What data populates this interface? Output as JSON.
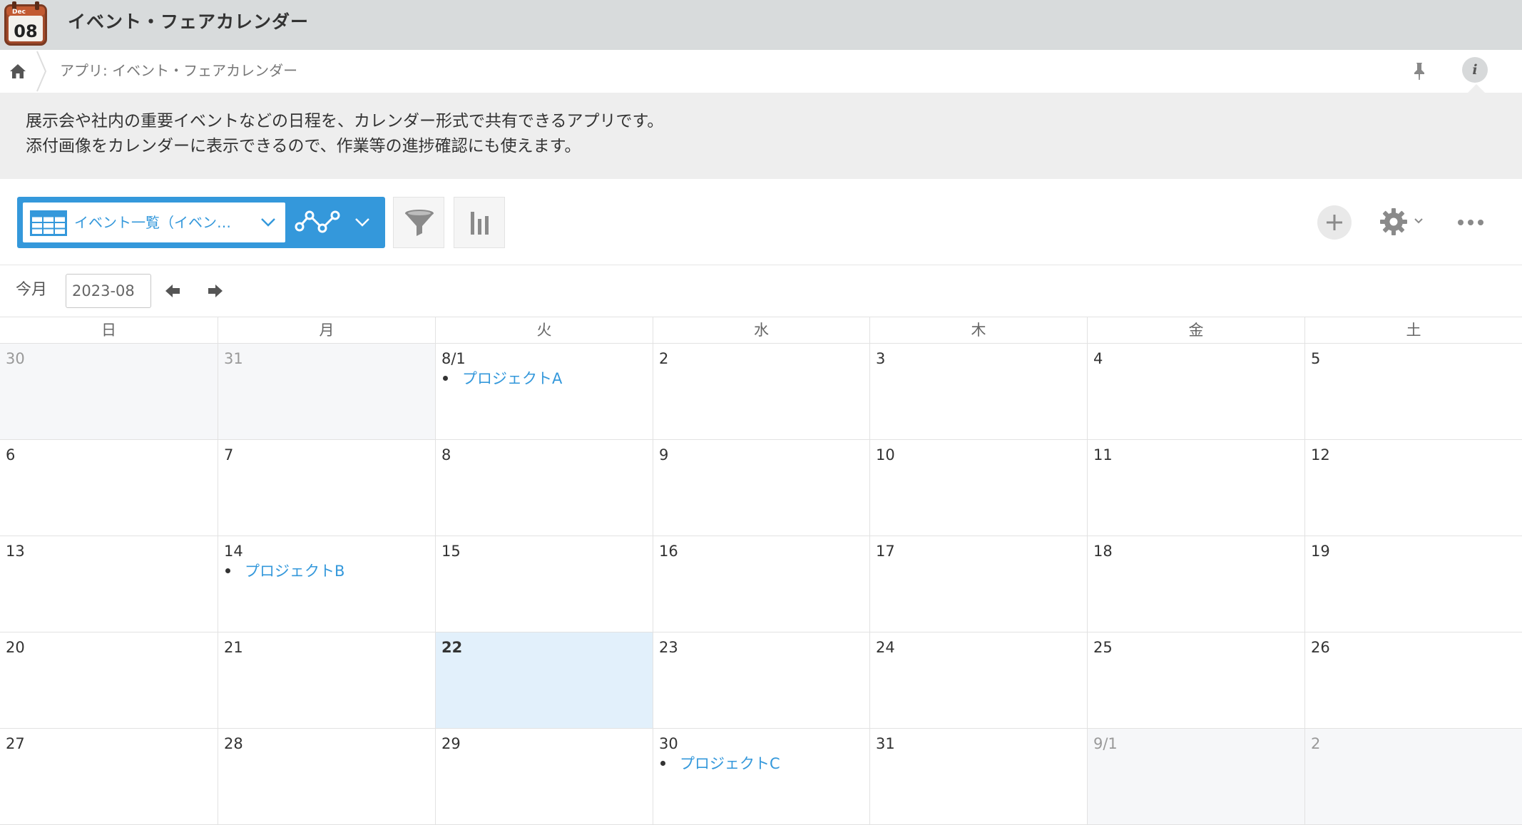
{
  "app": {
    "title": "イベント・フェアカレンダー",
    "icon_month": "Dec",
    "icon_day": "08"
  },
  "breadcrumb": {
    "text": "アプリ: イベント・フェアカレンダー"
  },
  "description": {
    "line1": "展示会や社内の重要イベントなどの日程を、カレンダー形式で共有できるアプリです。",
    "line2": "添付画像をカレンダーに表示できるので、作業等の進捗確認にも使えます。"
  },
  "toolbar": {
    "view_label": "イベント一覧（イベン…"
  },
  "month_nav": {
    "today_label": "今月",
    "month_value": "2023-08"
  },
  "calendar": {
    "weekdays": [
      "日",
      "月",
      "火",
      "水",
      "木",
      "金",
      "土"
    ],
    "weeks": [
      [
        {
          "day": "30",
          "other": true
        },
        {
          "day": "31",
          "other": true
        },
        {
          "day": "8/1",
          "events": [
            "プロジェクトA"
          ]
        },
        {
          "day": "2"
        },
        {
          "day": "3"
        },
        {
          "day": "4"
        },
        {
          "day": "5"
        }
      ],
      [
        {
          "day": "6"
        },
        {
          "day": "7"
        },
        {
          "day": "8"
        },
        {
          "day": "9"
        },
        {
          "day": "10"
        },
        {
          "day": "11"
        },
        {
          "day": "12"
        }
      ],
      [
        {
          "day": "13"
        },
        {
          "day": "14",
          "events": [
            "プロジェクトB"
          ]
        },
        {
          "day": "15"
        },
        {
          "day": "16"
        },
        {
          "day": "17"
        },
        {
          "day": "18"
        },
        {
          "day": "19"
        }
      ],
      [
        {
          "day": "20"
        },
        {
          "day": "21"
        },
        {
          "day": "22",
          "today": true
        },
        {
          "day": "23"
        },
        {
          "day": "24"
        },
        {
          "day": "25"
        },
        {
          "day": "26"
        }
      ],
      [
        {
          "day": "27"
        },
        {
          "day": "28"
        },
        {
          "day": "29"
        },
        {
          "day": "30",
          "events": [
            "プロジェクトC"
          ]
        },
        {
          "day": "31"
        },
        {
          "day": "9/1",
          "other": true
        },
        {
          "day": "2",
          "other": true
        }
      ]
    ]
  },
  "colors": {
    "accent": "#3498db",
    "header_bg": "#d8dbdc",
    "today_bg": "#e2f0fb",
    "other_month_bg": "#f6f7f9"
  }
}
